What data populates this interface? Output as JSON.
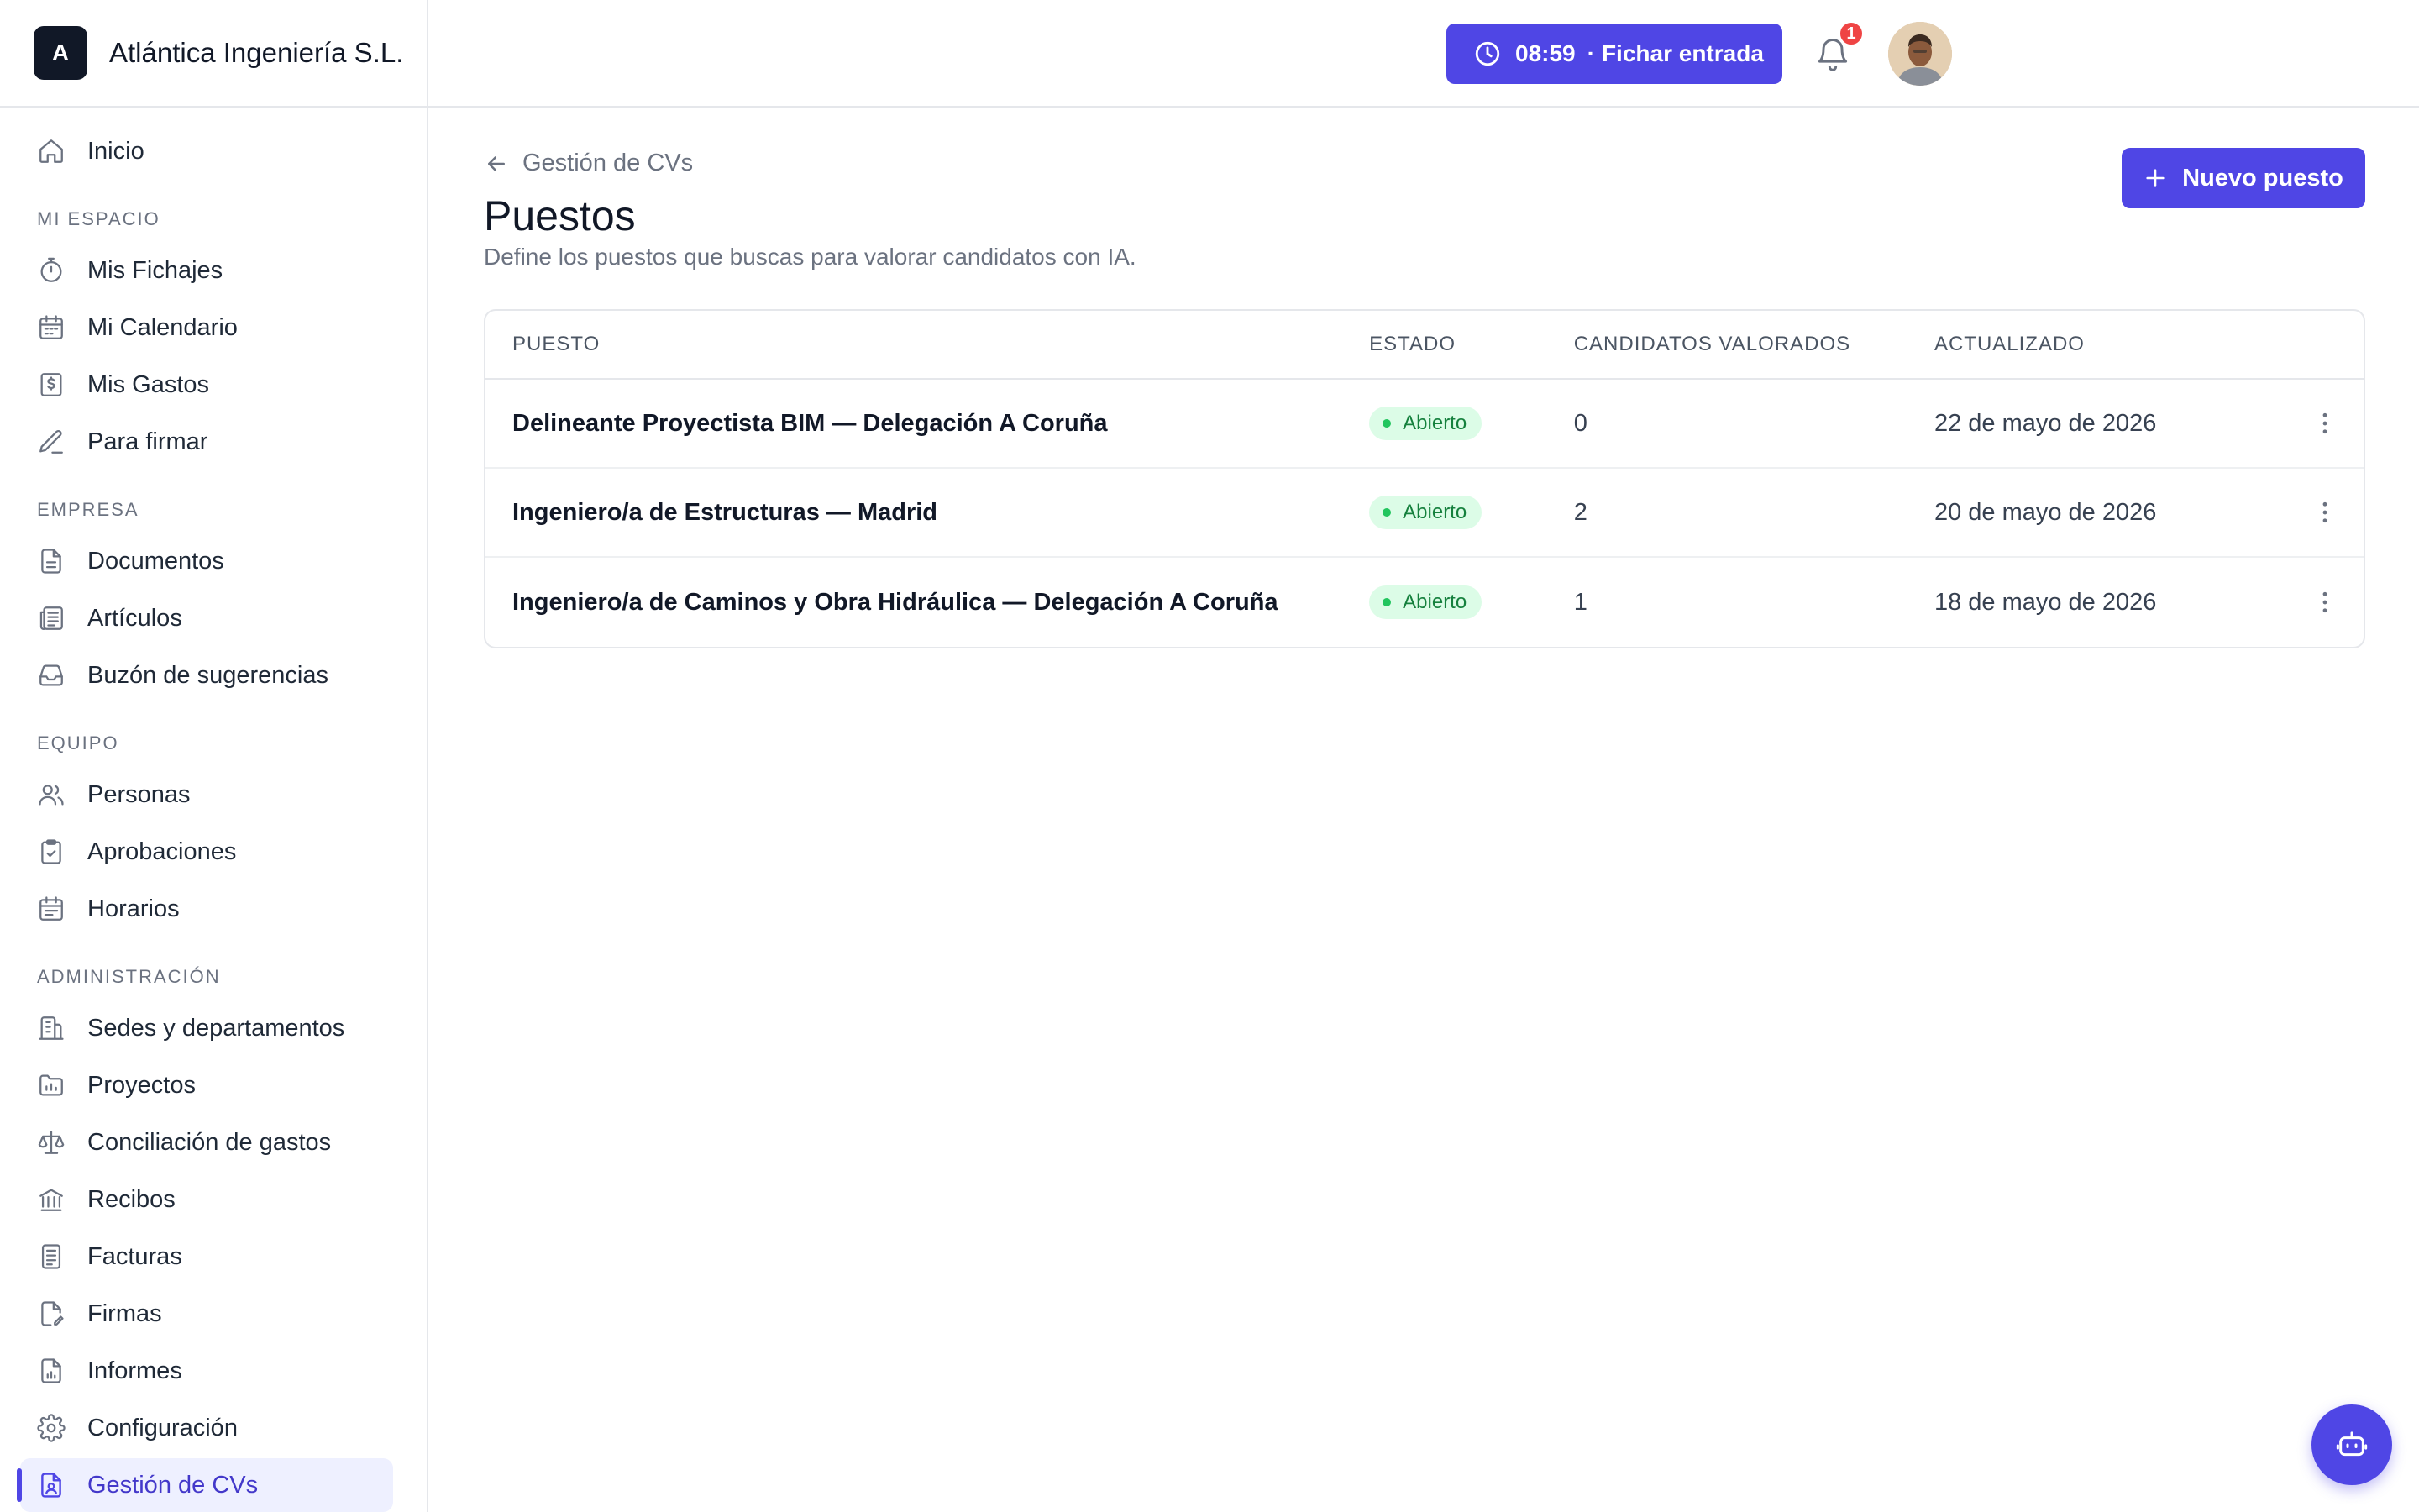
{
  "brand": {
    "initial": "A",
    "name": "Atlántica Ingeniería S.L."
  },
  "sidebar": {
    "home": {
      "label": "Inicio",
      "icon": "home-icon"
    },
    "sections": [
      {
        "title": "MI ESPACIO",
        "items": [
          {
            "label": "Mis Fichajes",
            "icon": "stopwatch-icon"
          },
          {
            "label": "Mi Calendario",
            "icon": "calendar-icon"
          },
          {
            "label": "Mis Gastos",
            "icon": "receipt-dollar-icon"
          },
          {
            "label": "Para firmar",
            "icon": "pen-icon"
          }
        ]
      },
      {
        "title": "EMPRESA",
        "items": [
          {
            "label": "Documentos",
            "icon": "document-icon"
          },
          {
            "label": "Artículos",
            "icon": "newspaper-icon"
          },
          {
            "label": "Buzón de sugerencias",
            "icon": "inbox-icon"
          }
        ]
      },
      {
        "title": "EQUIPO",
        "items": [
          {
            "label": "Personas",
            "icon": "users-icon"
          },
          {
            "label": "Aprobaciones",
            "icon": "clipboard-check-icon"
          },
          {
            "label": "Horarios",
            "icon": "schedule-icon"
          }
        ]
      },
      {
        "title": "ADMINISTRACIÓN",
        "items": [
          {
            "label": "Sedes y departamentos",
            "icon": "building-icon"
          },
          {
            "label": "Proyectos",
            "icon": "folder-chart-icon"
          },
          {
            "label": "Conciliación de gastos",
            "icon": "scale-icon"
          },
          {
            "label": "Recibos",
            "icon": "bank-icon"
          },
          {
            "label": "Facturas",
            "icon": "invoice-icon"
          },
          {
            "label": "Firmas",
            "icon": "file-signature-icon"
          },
          {
            "label": "Informes",
            "icon": "file-chart-icon"
          },
          {
            "label": "Configuración",
            "icon": "gear-icon"
          },
          {
            "label": "Gestión de CVs",
            "icon": "file-user-icon",
            "active": true
          }
        ]
      }
    ]
  },
  "header": {
    "clock_time": "08:59",
    "clock_sep": "·",
    "clock_action": "Fichar entrada",
    "notifications_count": "1"
  },
  "main": {
    "back_label": "Gestión de CVs",
    "title": "Puestos",
    "subtitle": "Define los puestos que buscas para valorar candidatos con IA.",
    "new_button": "Nuevo puesto",
    "table": {
      "headers": {
        "puesto": "PUESTO",
        "estado": "ESTADO",
        "candidatos": "CANDIDATOS VALORADOS",
        "actualizado": "ACTUALIZADO"
      },
      "rows": [
        {
          "puesto": "Delineante Proyectista BIM — Delegación A Coruña",
          "estado": "Abierto",
          "candidatos": "0",
          "actualizado": "22 de mayo de 2026"
        },
        {
          "puesto": "Ingeniero/a de Estructuras — Madrid",
          "estado": "Abierto",
          "candidatos": "2",
          "actualizado": "20 de mayo de 2026"
        },
        {
          "puesto": "Ingeniero/a de Caminos y Obra Hidráulica — Delegación A Coruña",
          "estado": "Abierto",
          "candidatos": "1",
          "actualizado": "18 de mayo de 2026"
        }
      ]
    }
  },
  "colors": {
    "accent": "#4f46e5",
    "status_open_bg": "#dcfce7",
    "status_open_text": "#15803d",
    "badge_red": "#ef4444"
  }
}
